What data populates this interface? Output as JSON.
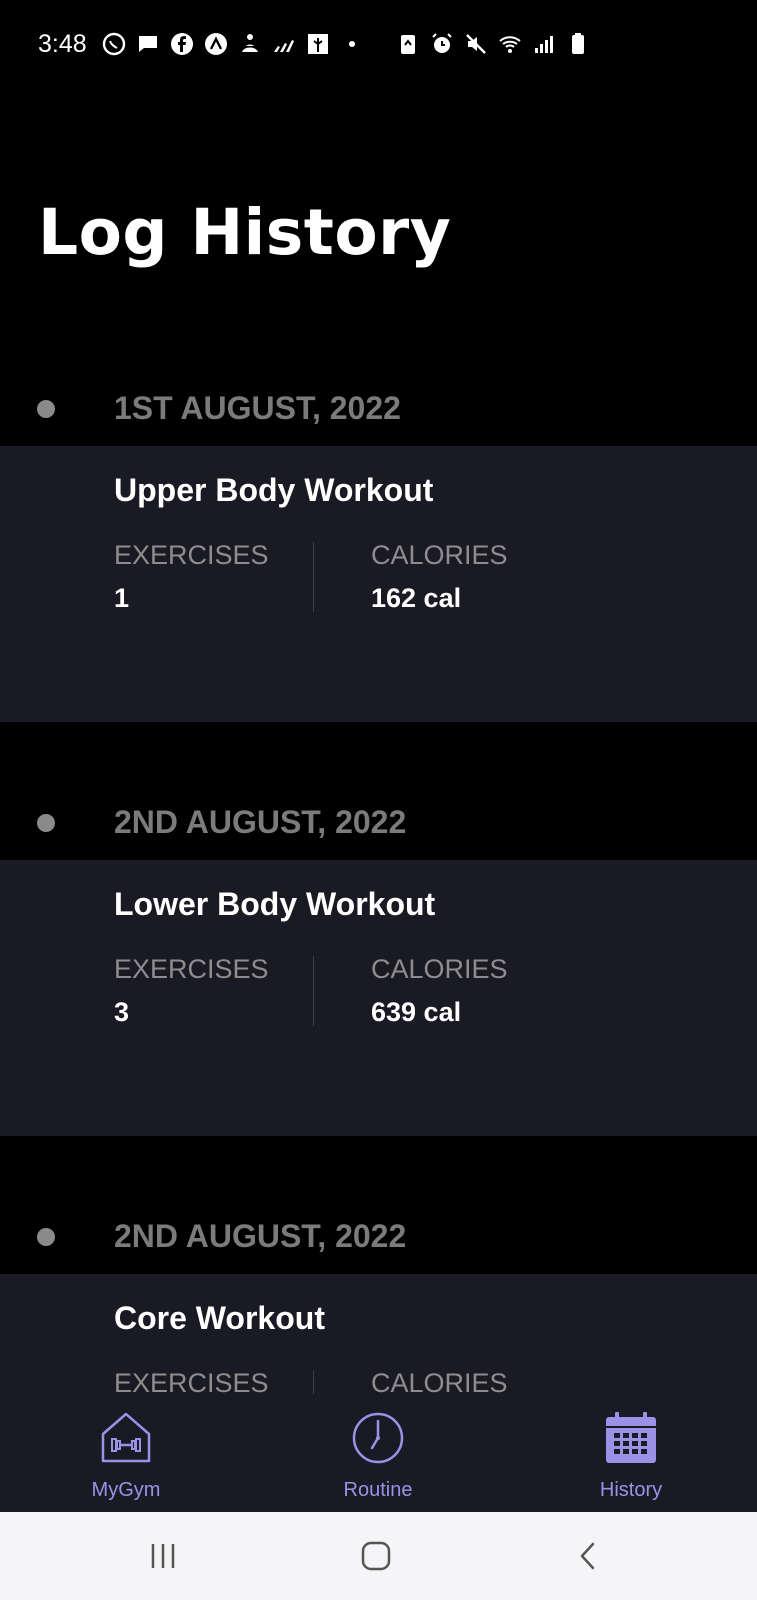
{
  "status_bar": {
    "time": "3:48"
  },
  "page": {
    "title": "Log History"
  },
  "logs": [
    {
      "date": "1ST AUGUST, 2022",
      "workout_name": "Upper Body Workout",
      "exercises_label": "EXERCISES",
      "exercises_value": "1",
      "calories_label": "CALORIES",
      "calories_value": "162 cal"
    },
    {
      "date": "2ND AUGUST, 2022",
      "workout_name": "Lower Body Workout",
      "exercises_label": "EXERCISES",
      "exercises_value": "3",
      "calories_label": "CALORIES",
      "calories_value": "639 cal"
    },
    {
      "date": "2ND AUGUST, 2022",
      "workout_name": "Core Workout",
      "exercises_label": "EXERCISES",
      "calories_label": "CALORIES"
    }
  ],
  "bottom_nav": {
    "items": [
      {
        "label": "MyGym",
        "icon": "home-dumbbell-icon"
      },
      {
        "label": "Routine",
        "icon": "clock-icon"
      },
      {
        "label": "History",
        "icon": "calendar-icon",
        "active": true
      }
    ]
  },
  "colors": {
    "background": "#000000",
    "card": "#1a1a25",
    "accent": "#9b92e8",
    "muted_text": "#7b7b7b"
  }
}
